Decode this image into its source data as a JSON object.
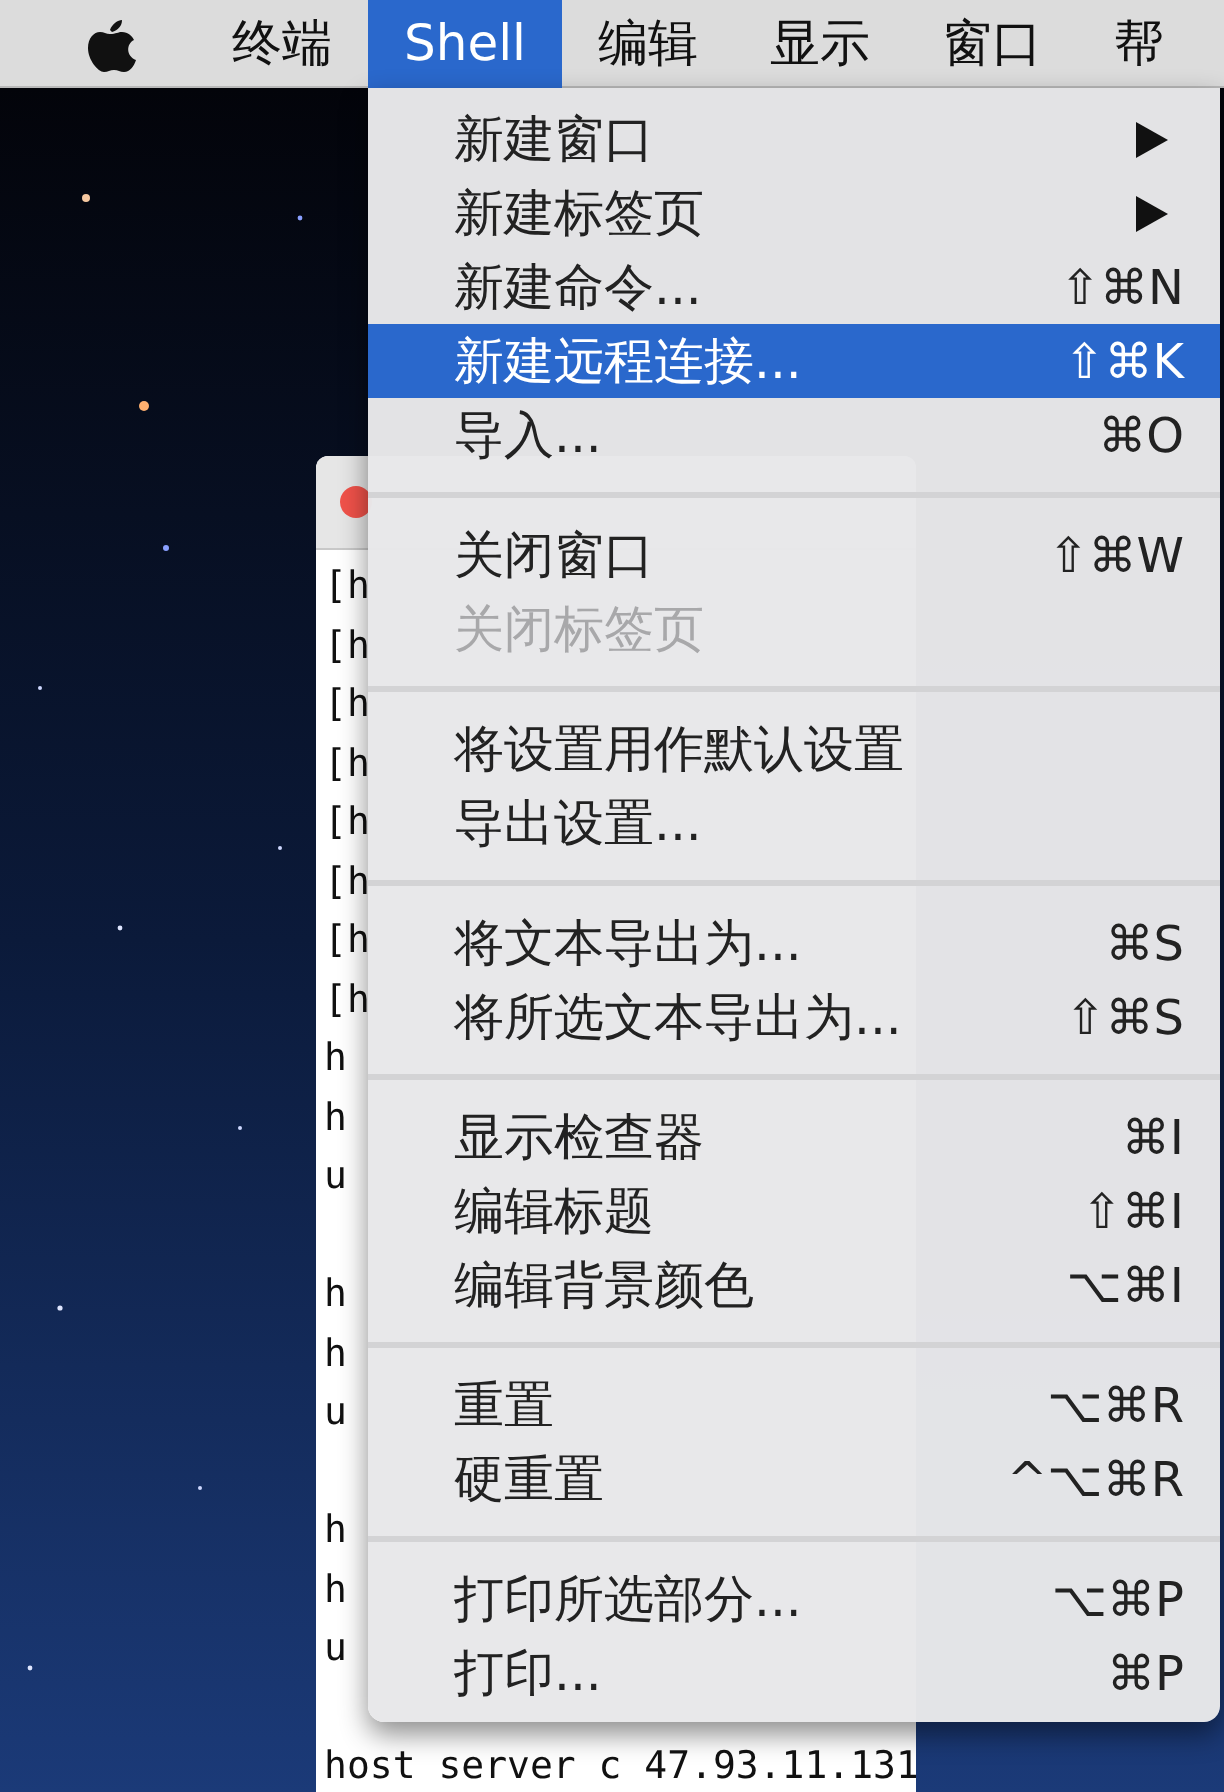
{
  "menubar": {
    "items": [
      {
        "label": "终端",
        "selected": false
      },
      {
        "label": "Shell",
        "selected": true
      },
      {
        "label": "编辑",
        "selected": false
      },
      {
        "label": "显示",
        "selected": false
      },
      {
        "label": "窗口",
        "selected": false
      },
      {
        "label": "帮",
        "selected": false
      }
    ]
  },
  "menu": {
    "groups": [
      {
        "items": [
          {
            "label": "新建窗口",
            "has_submenu": true,
            "selected": false,
            "disabled": false
          },
          {
            "label": "新建标签页",
            "has_submenu": true,
            "selected": false,
            "disabled": false
          },
          {
            "label": "新建命令...",
            "shortcut": "⇧⌘N",
            "has_submenu": false,
            "selected": false,
            "disabled": false
          },
          {
            "label": "新建远程连接...",
            "shortcut": "⇧⌘K",
            "has_submenu": false,
            "selected": true,
            "disabled": false
          },
          {
            "label": "导入...",
            "shortcut": "⌘O",
            "has_submenu": false,
            "selected": false,
            "disabled": false
          }
        ]
      },
      {
        "items": [
          {
            "label": "关闭窗口",
            "shortcut": "⇧⌘W",
            "has_submenu": false,
            "selected": false,
            "disabled": false
          },
          {
            "label": "关闭标签页",
            "has_submenu": false,
            "selected": false,
            "disabled": true
          }
        ]
      },
      {
        "items": [
          {
            "label": "将设置用作默认设置",
            "has_submenu": false,
            "selected": false,
            "disabled": false
          },
          {
            "label": "导出设置...",
            "has_submenu": false,
            "selected": false,
            "disabled": false
          }
        ]
      },
      {
        "items": [
          {
            "label": "将文本导出为...",
            "shortcut": "⌘S",
            "has_submenu": false,
            "selected": false,
            "disabled": false
          },
          {
            "label": "将所选文本导出为...",
            "shortcut": "⇧⌘S",
            "has_submenu": false,
            "selected": false,
            "disabled": false
          }
        ]
      },
      {
        "items": [
          {
            "label": "显示检查器",
            "shortcut": "⌘I",
            "has_submenu": false,
            "selected": false,
            "disabled": false
          },
          {
            "label": "编辑标题",
            "shortcut": "⇧⌘I",
            "has_submenu": false,
            "selected": false,
            "disabled": false
          },
          {
            "label": "编辑背景颜色",
            "shortcut": "⌥⌘I",
            "has_submenu": false,
            "selected": false,
            "disabled": false
          }
        ]
      },
      {
        "items": [
          {
            "label": "重置",
            "shortcut": "⌥⌘R",
            "has_submenu": false,
            "selected": false,
            "disabled": false
          },
          {
            "label": "硬重置",
            "shortcut": "^⌥⌘R",
            "has_submenu": false,
            "selected": false,
            "disabled": false
          }
        ]
      },
      {
        "items": [
          {
            "label": "打印所选部分...",
            "shortcut": "⌥⌘P",
            "has_submenu": false,
            "selected": false,
            "disabled": false
          },
          {
            "label": "打印...",
            "shortcut": "⌘P",
            "has_submenu": false,
            "selected": false,
            "disabled": false
          }
        ]
      }
    ]
  },
  "terminal": {
    "blocks": [
      [
        "[h",
        "[h",
        "[h",
        "[h",
        "[h",
        "[h",
        "[h",
        "[h",
        "h",
        "h",
        "u"
      ],
      [
        "h",
        "h",
        "u"
      ],
      [
        "h",
        "h",
        "u"
      ],
      [
        "host server c 47.93.11.131"
      ]
    ]
  }
}
